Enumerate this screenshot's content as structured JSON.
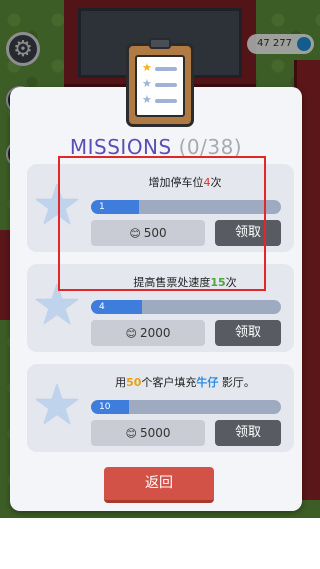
{
  "hud": {
    "coin_amount": "47 277",
    "settings_icon": "gear-icon"
  },
  "dialog": {
    "title": "MISSIONS",
    "progress": "(0/38)",
    "header_icon": "clipboard-icon",
    "back_label": "返回"
  },
  "missions": [
    {
      "text_before": "增加停车位",
      "highlight": "4",
      "text_after": "次",
      "progress_value": "1",
      "progress_fraction": 0.25,
      "reward": "500",
      "claim_label": "领取"
    },
    {
      "text_before": "提高售票处速度",
      "highlight": "15",
      "text_after": "次",
      "progress_value": "4",
      "progress_fraction": 0.27,
      "reward": "2000",
      "claim_label": "领取"
    },
    {
      "text_before": "用",
      "highlight": "50",
      "text_middle": "个客户填充",
      "highlight2": "牛仔",
      "text_after": " 影厅。",
      "progress_value": "10",
      "progress_fraction": 0.2,
      "reward": "5000",
      "claim_label": "领取"
    }
  ],
  "colors": {
    "title": "#5a4fb6",
    "progress_fill": "#3e7ddc",
    "back_button": "#d35248",
    "claim_button": "#585b61",
    "highlight_frame": "#e32626"
  }
}
